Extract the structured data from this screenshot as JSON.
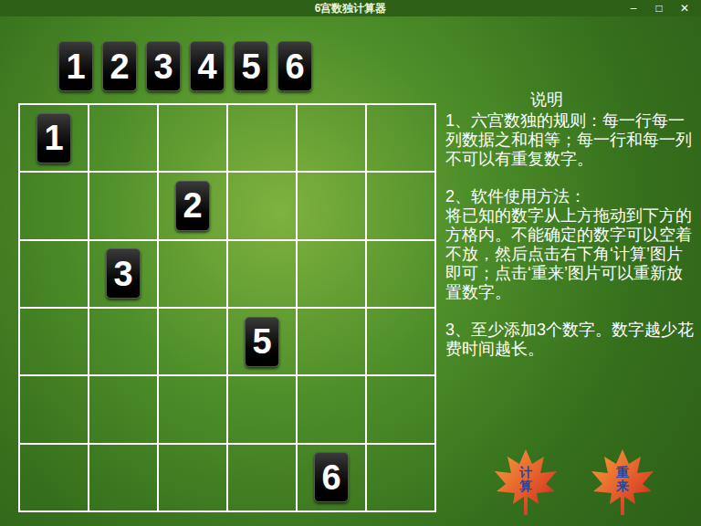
{
  "window": {
    "title": "6宫数独计算器",
    "controls": [
      "–",
      "□",
      "✕"
    ]
  },
  "palette": [
    "1",
    "2",
    "3",
    "4",
    "5",
    "6"
  ],
  "board": [
    [
      "1",
      "",
      "",
      "",
      "",
      ""
    ],
    [
      "",
      "",
      "2",
      "",
      "",
      ""
    ],
    [
      "",
      "3",
      "",
      "",
      "",
      ""
    ],
    [
      "",
      "",
      "",
      "5",
      "",
      ""
    ],
    [
      "",
      "",
      "",
      "",
      "",
      ""
    ],
    [
      "",
      "",
      "",
      "",
      "6",
      ""
    ]
  ],
  "instructions": {
    "heading": "说明",
    "paragraphs": [
      [
        "1、六宫数独的规则：每一行每一列数据之和相等；每一行和每一列不可以有重复数字。"
      ],
      [
        "2、软件使用方法：",
        "将已知的数字从上方拖动到下方的方格内。不能确定的数字可以空着不放，然后点击右下角‘计算’图片即可；点击‘重来’图片可以重新放置数字。"
      ],
      [
        "3、至少添加3个数字。数字越少花费时间越长。"
      ]
    ]
  },
  "buttons": [
    "计算",
    "重来"
  ]
}
